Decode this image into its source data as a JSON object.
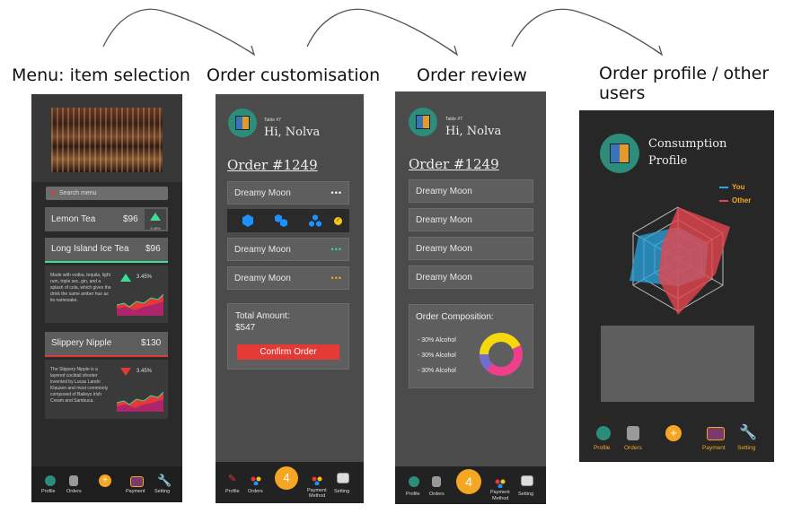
{
  "captions": [
    "Menu: item selection",
    "Order customisation",
    "Order review",
    "Order profile / other users"
  ],
  "screen1": {
    "search_placeholder": "Search menu",
    "lemon": {
      "name": "Lemon Tea",
      "price": "$96",
      "badge": "3.45%"
    },
    "long_island": {
      "name": "Long Island Ice Tea",
      "price": "$96",
      "desc": "Made with vodka, tequila, light rum, triple sec, gin, and a splash of cola, which gives the drink the same amber hue as its namesake.",
      "pct": "3.45%"
    },
    "slippery": {
      "name": "Slippery Nipple",
      "price": "$130",
      "desc": "The Slippery Nipple is a layered cocktail shooter invented by Lucas Lando Klausen and most commonly composed of Baileys Irish Cream and Sambuca.",
      "pct": "3.45%"
    }
  },
  "screen2": {
    "table": "Table #7",
    "greeting": "Hi, Nolva",
    "order": "Order #1249",
    "items": [
      "Dreamy Moon",
      "Dreamy Moon",
      "Dreamy Moon"
    ],
    "dots": "•••",
    "total_label": "Total Amount:",
    "total_value": "$547",
    "confirm": "Confirm Order"
  },
  "screen3": {
    "table": "Table #7",
    "greeting": "Hi, Nolva",
    "order": "Order #1249",
    "items": [
      "Dreamy Moon",
      "Dreamy Moon",
      "Dreamy Moon",
      "Dreamy Moon"
    ],
    "composition_title": "Order Composition:",
    "composition": [
      "- 30% Alcohol",
      "- 30% Alcohol",
      "- 30% Alcohol"
    ]
  },
  "screen4": {
    "title_line1": "Consumption",
    "title_line2": "Profile",
    "legend": [
      {
        "label": "You",
        "color": "#2aa6e0"
      },
      {
        "label": "Other",
        "color": "#e5464f"
      }
    ]
  },
  "nav": {
    "profile": "Profile",
    "orders": "Orders",
    "payment": "Payment",
    "setting": "Setting",
    "payment_method_1": "Payment",
    "payment_method_2": "Method",
    "badge": "4"
  },
  "colors": {
    "accent": "#f5a623",
    "red": "#e53935",
    "teal": "#3ddc97"
  }
}
